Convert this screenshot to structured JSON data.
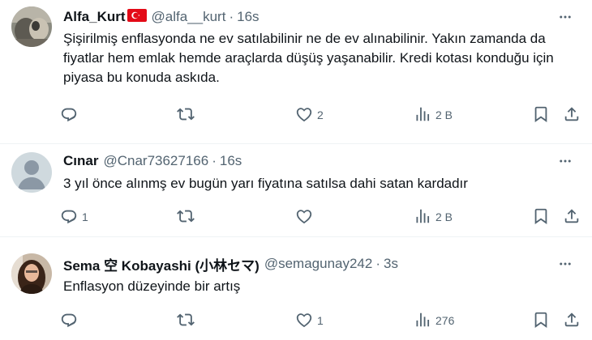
{
  "replies": [
    {
      "name": "Alfa_Kurt",
      "handle": "@alfa__kurt",
      "dot": "·",
      "time": "16s",
      "text": "Şişirilmiş enflasyonda ne ev satılabilinir  ne de ev alınabilinir. Yakın zamanda da fiyatlar hem emlak hemde araçlarda düşüş yaşanabilir. Kredi kotası konduğu için piyasa bu konuda askıda.",
      "replies_count": "",
      "retweets_count": "",
      "likes_count": "2",
      "views_count": "2 B"
    },
    {
      "name": "Cınar",
      "handle": "@Cnar73627166",
      "dot": "·",
      "time": "16s",
      "text": "3 yıl önce alınmş ev bugün yarı fiyatına satılsa dahi satan kardadır",
      "replies_count": "1",
      "retweets_count": "",
      "likes_count": "",
      "views_count": "2 B"
    },
    {
      "name": "Sema 空 Kobayashi (小林セマ)",
      "handle": "@semagunay242",
      "dot": "·",
      "time": "3s",
      "text": "Enflasyon düzeyinde bir artış",
      "replies_count": "",
      "retweets_count": "",
      "likes_count": "1",
      "views_count": "276"
    }
  ],
  "colors": {
    "text": "#0f1419",
    "secondary": "#536471",
    "divider": "#eff3f4",
    "flag_red": "#e30a17"
  },
  "icons": [
    "more-icon",
    "reply-icon",
    "retweet-icon",
    "like-icon",
    "views-icon",
    "bookmark-icon",
    "share-icon",
    "turkish-flag-icon"
  ]
}
